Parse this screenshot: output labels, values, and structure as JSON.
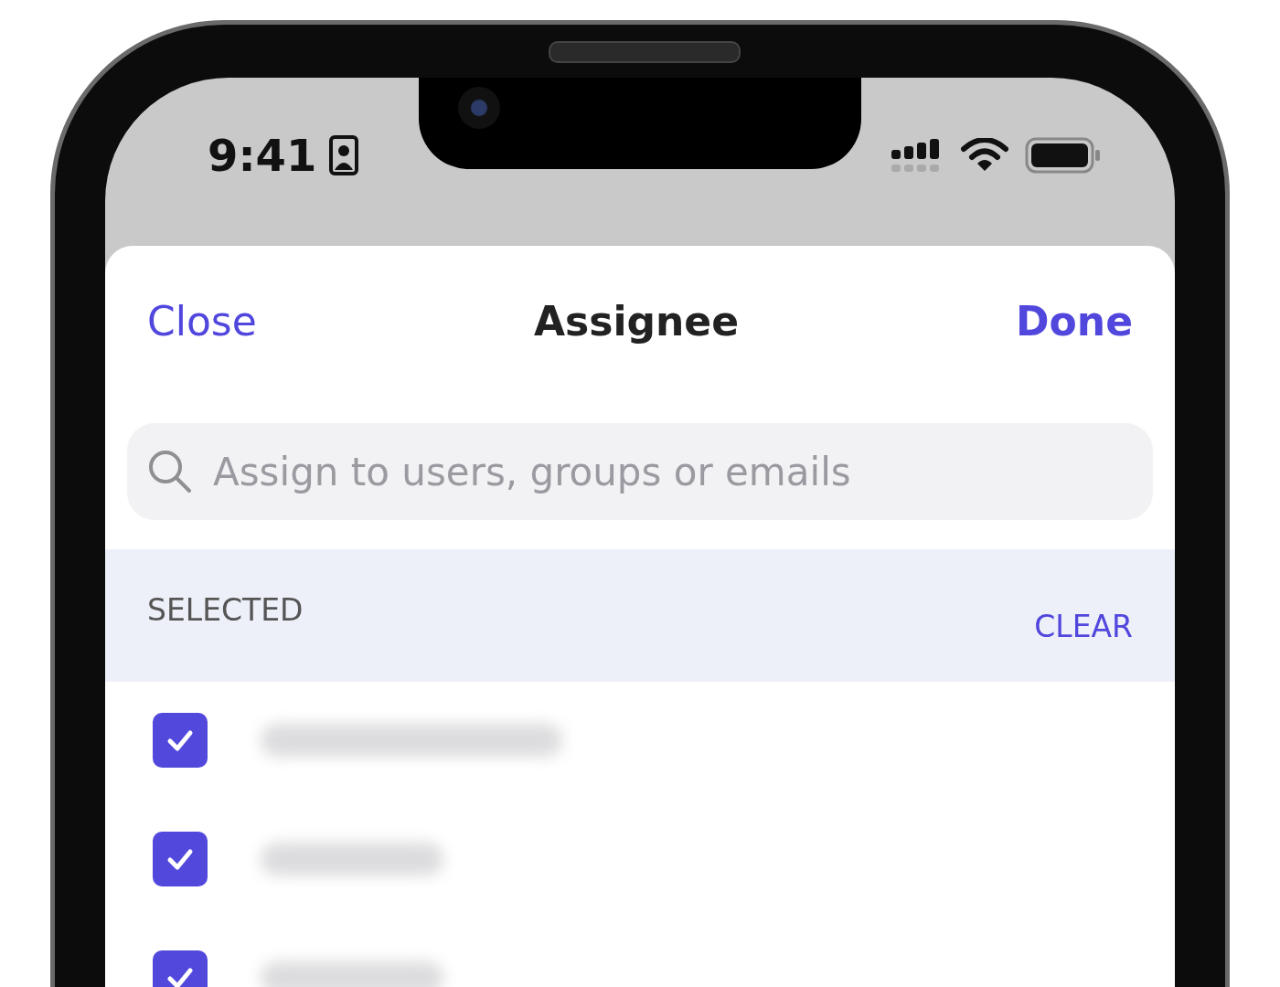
{
  "status_bar": {
    "time": "9:41"
  },
  "header": {
    "close": "Close",
    "title": "Assignee",
    "done": "Done"
  },
  "search": {
    "placeholder": "Assign to users, groups or emails"
  },
  "section": {
    "title": "SELECTED",
    "action": "CLEAR"
  },
  "assignees": [
    {
      "checked": true
    },
    {
      "checked": true
    },
    {
      "checked": true
    }
  ]
}
